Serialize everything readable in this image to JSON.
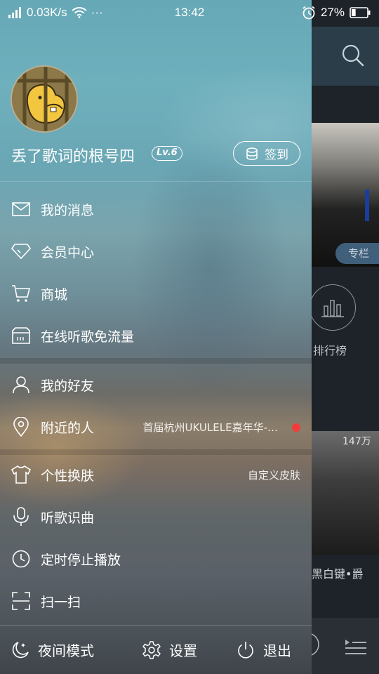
{
  "status_bar": {
    "network_speed": "0.03K/s",
    "more": "···",
    "time": "13:42",
    "battery": "27%",
    "battery_level": 0.27
  },
  "background_app": {
    "album_tag": "专栏",
    "rank_label": "排行榜",
    "play_count": "147万",
    "photo_title": "黑白键•爵"
  },
  "profile": {
    "username": "丢了歌词的根号四",
    "level": "Lv.6",
    "checkin_label": "签到"
  },
  "menu": {
    "messages": "我的消息",
    "vip": "会员中心",
    "mall": "商城",
    "free_traffic": "在线听歌免流量",
    "friends": "我的好友",
    "nearby": "附近的人",
    "nearby_extra": "首届杭州UKULELE嘉年华-…",
    "skin": "个性换肤",
    "skin_extra": "自定义皮肤",
    "identify": "听歌识曲",
    "timer": "定时停止播放",
    "scan": "扫一扫"
  },
  "footer": {
    "night_mode": "夜间模式",
    "settings": "设置",
    "logout": "退出"
  }
}
